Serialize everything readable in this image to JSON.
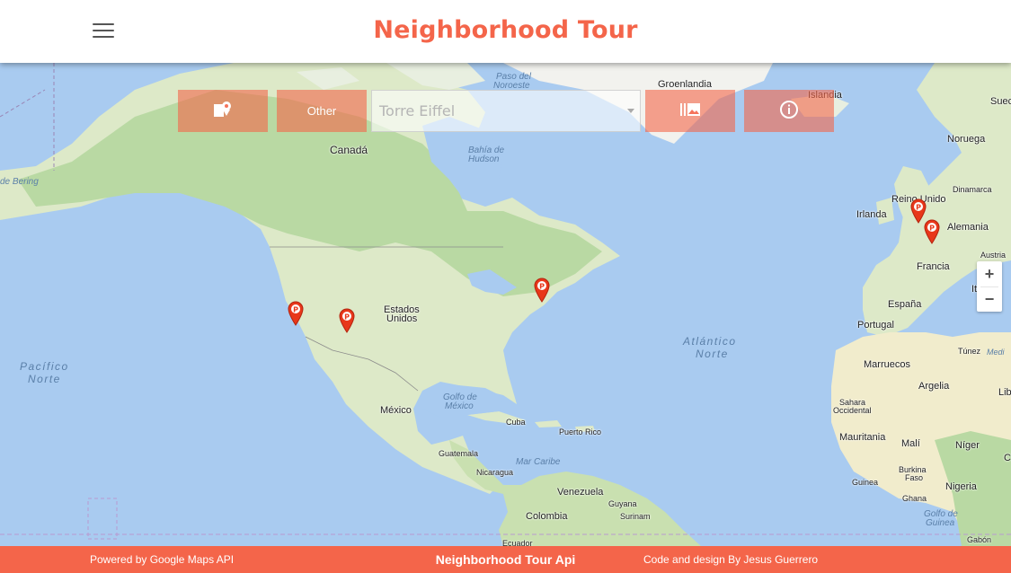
{
  "header": {
    "title": "Neighborhood Tour",
    "menu_icon": "hamburger-menu-icon"
  },
  "toolbar": {
    "places_icon": "map-pin-icon",
    "category_label": "Other",
    "place_select_value": "Torre Eiffel",
    "gallery_icon": "photo-library-icon",
    "info_icon": "info-icon",
    "accent_color": "#f4654a"
  },
  "map": {
    "labels": {
      "canada": "Canadá",
      "groenlandia": "Groenlandia",
      "islandia": "Islandia",
      "suecia": "Suec",
      "noruega": "Noruega",
      "paso1": "Paso del",
      "paso2": "Noroeste",
      "bahia1": "Bahía de",
      "bahia2": "Hudson",
      "bering": "de Bering",
      "reino_unido": "Reino Unido",
      "dinamarca": "Dinamarca",
      "irlanda": "Irlanda",
      "alemania": "Alemania",
      "austria": "Austria",
      "francia": "Francia",
      "italia": "It",
      "espana": "España",
      "portugal": "Portugal",
      "estados1": "Estados",
      "estados2": "Unidos",
      "atlantico1": "Atlántico",
      "atlantico2": "Norte",
      "pacifico1": "Pacífico",
      "pacifico2": "Norte",
      "marruecos": "Marruecos",
      "tunez": "Túnez",
      "medi": "Medi",
      "argelia": "Argelia",
      "lib": "Lib",
      "golfo_mexico1": "Golfo de",
      "golfo_mexico2": "México",
      "mexico": "México",
      "cuba": "Cuba",
      "puerto_rico": "Puerto Rico",
      "sahara1": "Sahara",
      "sahara2": "Occidental",
      "mauritania": "Mauritania",
      "mali": "Malí",
      "niger": "Níger",
      "guatemala": "Guatemala",
      "nicaragua": "Nicaragua",
      "mar_caribe": "Mar Caribe",
      "burkina1": "Burkina",
      "burkina2": "Faso",
      "guinea": "Guinea",
      "ghana": "Ghana",
      "nigeria": "Nigeria",
      "venezuela": "Venezuela",
      "guyana": "Guyana",
      "surinam": "Surinam",
      "colombia": "Colombia",
      "golfo_guinea1": "Golfo de",
      "golfo_guinea2": "Guinea",
      "ecuador": "Ecuador",
      "gabon": "Gabón",
      "c": "C"
    },
    "markers": [
      {
        "name": "San Francisco"
      },
      {
        "name": "Denver"
      },
      {
        "name": "New York"
      },
      {
        "name": "London"
      },
      {
        "name": "Paris"
      }
    ],
    "zoom_in": "+",
    "zoom_out": "−"
  },
  "footer": {
    "left": "Powered by Google Maps API",
    "center": "Neighborhood Tour Api",
    "right": "Code and design By Jesus Guerrero"
  }
}
